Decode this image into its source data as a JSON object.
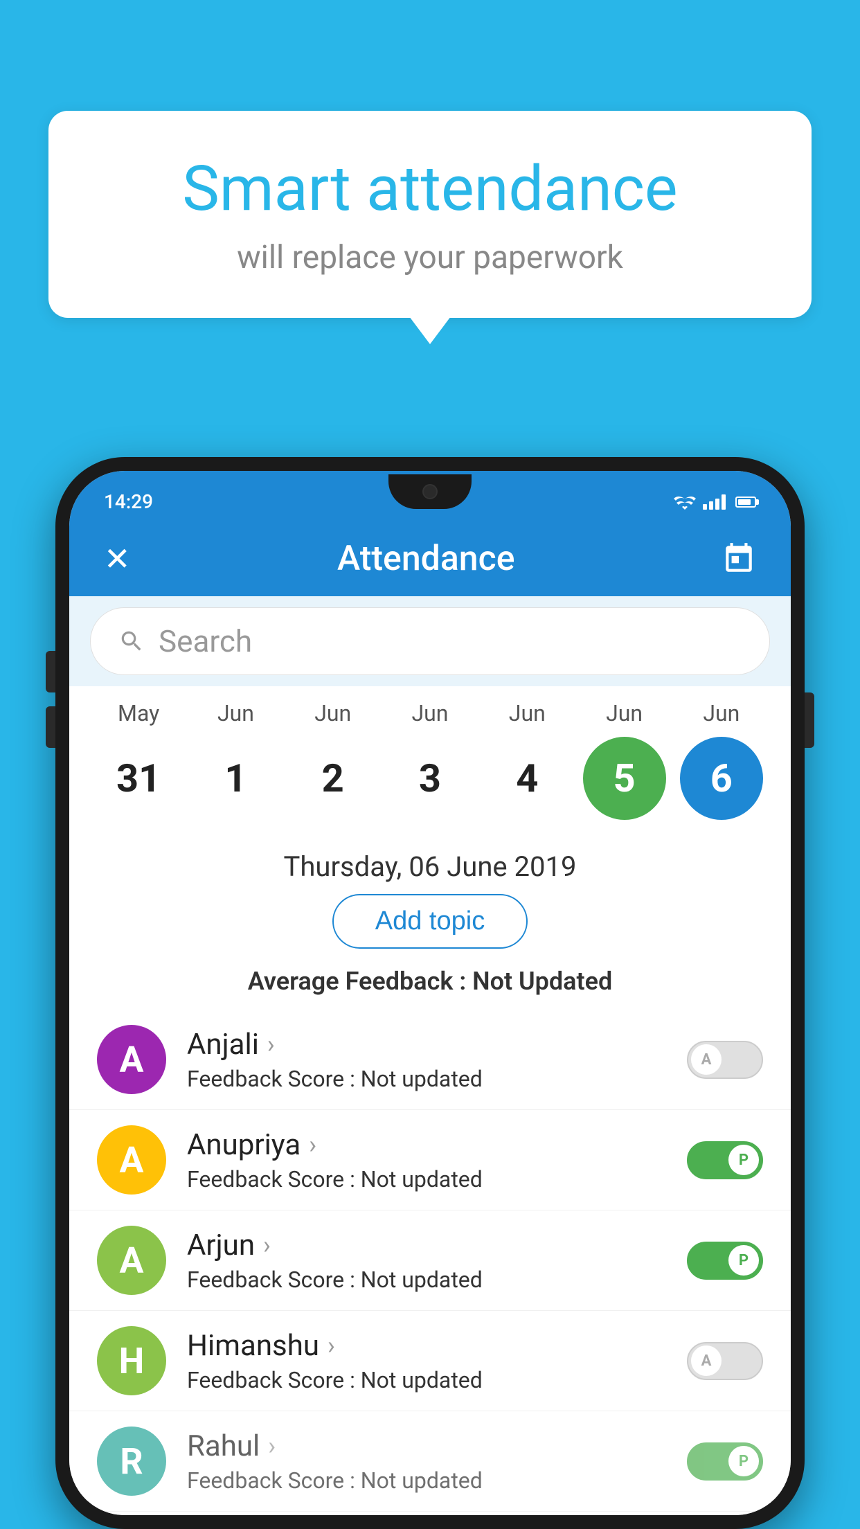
{
  "background_color": "#29b6e8",
  "bubble": {
    "title": "Smart attendance",
    "subtitle": "will replace your paperwork"
  },
  "status_bar": {
    "time": "14:29",
    "icons": [
      "wifi",
      "signal",
      "battery"
    ]
  },
  "header": {
    "title": "Attendance",
    "close_label": "✕",
    "calendar_label": "📅"
  },
  "search": {
    "placeholder": "Search"
  },
  "calendar": {
    "months": [
      "May",
      "Jun",
      "Jun",
      "Jun",
      "Jun",
      "Jun",
      "Jun"
    ],
    "dates": [
      "31",
      "1",
      "2",
      "3",
      "4",
      "5",
      "6"
    ],
    "active_green": "5",
    "active_blue": "6",
    "selected_date": "Thursday, 06 June 2019"
  },
  "add_topic_label": "Add topic",
  "avg_feedback": {
    "label": "Average Feedback : ",
    "value": "Not Updated"
  },
  "students": [
    {
      "name": "Anjali",
      "avatar_letter": "A",
      "avatar_color": "#9c27b0",
      "feedback": "Feedback Score : ",
      "feedback_value": "Not updated",
      "toggle_state": "off",
      "toggle_label": "A"
    },
    {
      "name": "Anupriya",
      "avatar_letter": "A",
      "avatar_color": "#ffc107",
      "feedback": "Feedback Score : ",
      "feedback_value": "Not updated",
      "toggle_state": "on",
      "toggle_label": "P"
    },
    {
      "name": "Arjun",
      "avatar_letter": "A",
      "avatar_color": "#8bc34a",
      "feedback": "Feedback Score : ",
      "feedback_value": "Not updated",
      "toggle_state": "on",
      "toggle_label": "P"
    },
    {
      "name": "Himanshu",
      "avatar_letter": "H",
      "avatar_color": "#8bc34a",
      "feedback": "Feedback Score : ",
      "feedback_value": "Not updated",
      "toggle_state": "off",
      "toggle_label": "A"
    },
    {
      "name": "Rahul",
      "avatar_letter": "R",
      "avatar_color": "#26a69a",
      "feedback": "Feedback Score : ",
      "feedback_value": "Not updated",
      "toggle_state": "on",
      "toggle_label": "P"
    }
  ]
}
